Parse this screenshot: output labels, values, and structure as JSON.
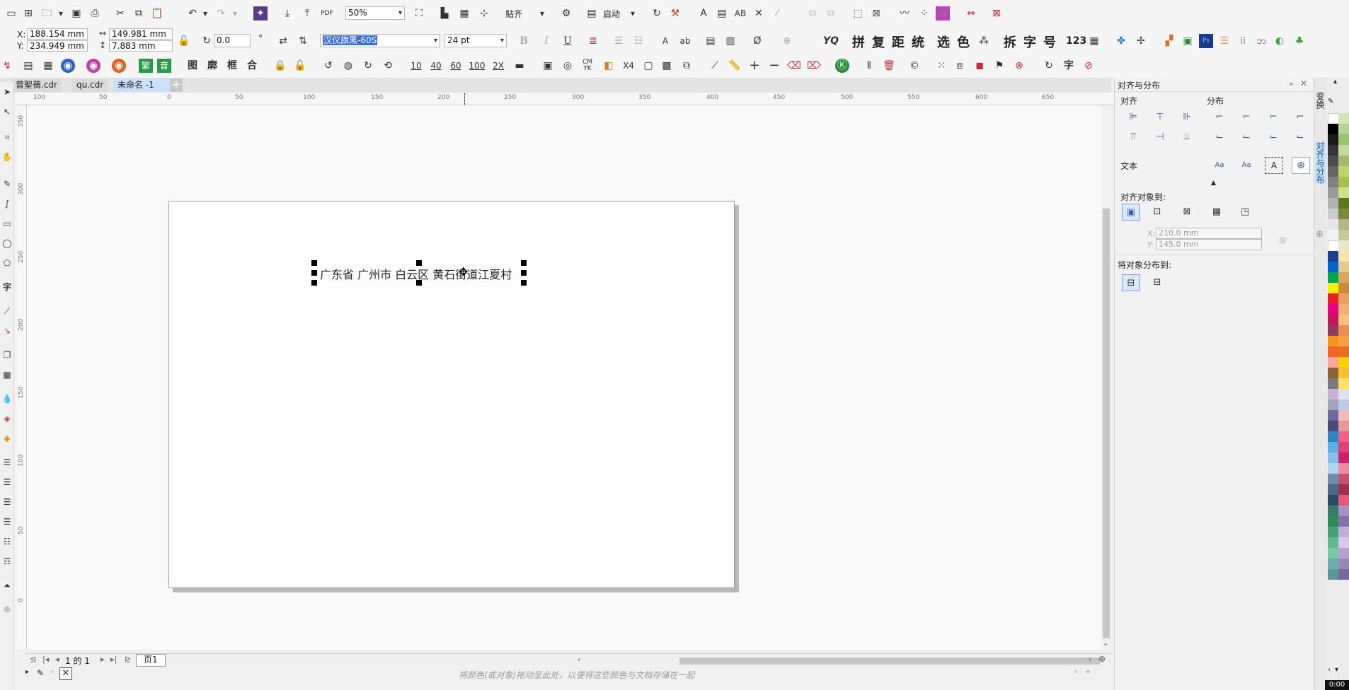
{
  "toolbar_top": {
    "zoom_value": "50%",
    "snap_label": "贴齐",
    "launch_label": "启动"
  },
  "property_bar": {
    "x_label": "X:",
    "x_value": "188.154 mm",
    "y_label": "Y:",
    "y_value": "234.949 mm",
    "width_value": "149.981 mm",
    "height_value": "7.883 mm",
    "rotation_value": "0.0",
    "font_name": "汉仪旗黑-60S",
    "font_size": "24 pt",
    "macro_buttons": [
      "拼",
      "复",
      "距",
      "统",
      "选",
      "色",
      "拆",
      "字",
      "号",
      "123"
    ]
  },
  "tool_row3": {
    "labels": [
      "繁",
      "音",
      "图",
      "廓",
      "框",
      "合",
      "10",
      "40",
      "60",
      "100",
      "2X",
      "CM YK",
      "X4",
      "字"
    ]
  },
  "doc_tabs": [
    {
      "label": "曾聖蒨.cdr",
      "active": false
    },
    {
      "label": "qu.cdr",
      "active": false
    },
    {
      "label": "未命名 -1",
      "active": true
    }
  ],
  "canvas": {
    "text_object": "广东省 广州市 白云区 黄石街道江夏村",
    "ruler_h": [
      "100",
      "50",
      "0",
      "50",
      "100",
      "150",
      "200",
      "250",
      "300",
      "350",
      "400",
      "450",
      "500",
      "550",
      "600",
      "650"
    ],
    "ruler_v": [
      "350",
      "300",
      "250",
      "200",
      "150",
      "100",
      "50",
      "0"
    ]
  },
  "page_nav": {
    "page_count": "1 的 1",
    "page_tab": "页1"
  },
  "status_bar": {
    "hint": "将颜色(或对象)拖动至此处，以便将这些颜色与文档存储在一起"
  },
  "align_panel": {
    "title": "对齐与分布",
    "align_heading": "对齐",
    "distribute_heading": "分布",
    "text_heading": "文本",
    "align_to_heading": "对齐对象到:",
    "x_label": "X:",
    "x_value": "210.0 mm",
    "y_label": "Y:",
    "y_value": "145.0 mm",
    "distribute_to_heading": "将对象分布到:"
  },
  "side_tabs": {
    "tab1": "变换",
    "tab2": "对齐与分布"
  },
  "clock": "0:00",
  "colors": {
    "accent": "#3b5ba5",
    "selection": "#3b6fd6"
  },
  "palette": [
    [
      "#ffffff",
      "#d4e6b5"
    ],
    [
      "#000000",
      "#b7d39a"
    ],
    [
      "#1a1a1a",
      "#98c46a"
    ],
    [
      "#333333",
      "#c6d9a3"
    ],
    [
      "#4d4d4d",
      "#a2b86a"
    ],
    [
      "#666666",
      "#bcd56b"
    ],
    [
      "#808080",
      "#a5c14a"
    ],
    [
      "#999999",
      "#d0e08a"
    ],
    [
      "#b3b3b3",
      "#5a7a1a"
    ],
    [
      "#cccccc",
      "#7a8a3a"
    ],
    [
      "#e6e6e6",
      "#b5b58a"
    ],
    [
      "#f2f2f2",
      "#c8c8a0"
    ],
    [
      "#ffffff",
      "#e8e8c8"
    ],
    [
      "#1c3f94",
      "#f5e6a8"
    ],
    [
      "#0066cc",
      "#e8c98a"
    ],
    [
      "#00a651",
      "#d9a55a"
    ],
    [
      "#fff200",
      "#c98a3a"
    ],
    [
      "#ed1c24",
      "#e8a060"
    ],
    [
      "#e4007f",
      "#f0b070"
    ],
    [
      "#c2185b",
      "#f5c080"
    ],
    [
      "#8e3a59",
      "#e89050"
    ],
    [
      "#f7941d",
      "#f5a040"
    ],
    [
      "#f26522",
      "#e87020"
    ],
    [
      "#f9a99b",
      "#fdd000"
    ],
    [
      "#8c6239",
      "#f5c030"
    ],
    [
      "#7a7a7a",
      "#ffe066"
    ],
    [
      "#c7b2d6",
      "#e0e0f0"
    ],
    [
      "#a3a3c2",
      "#c0c8e8"
    ],
    [
      "#6a6aa0",
      "#f4b8b8"
    ],
    [
      "#4a4a7a",
      "#e89898"
    ],
    [
      "#2e86c1",
      "#f06080"
    ],
    [
      "#5dade2",
      "#e0407a"
    ],
    [
      "#85c1e9",
      "#d0206a"
    ],
    [
      "#aed6f1",
      "#f08ca0"
    ],
    [
      "#6f8fa8",
      "#c85070"
    ],
    [
      "#4a6a88",
      "#a03050"
    ],
    [
      "#2a4a68",
      "#e85878"
    ],
    [
      "#3a7a6a",
      "#a890c0"
    ],
    [
      "#2e8b57",
      "#8870a8"
    ],
    [
      "#48a078",
      "#c0b0d8"
    ],
    [
      "#60b890",
      "#d8c8e8"
    ],
    [
      "#78c8a8",
      "#b8a0d0"
    ],
    [
      "#6ab0b0",
      "#9888b8"
    ],
    [
      "#5a9898",
      "#7868a0"
    ]
  ]
}
